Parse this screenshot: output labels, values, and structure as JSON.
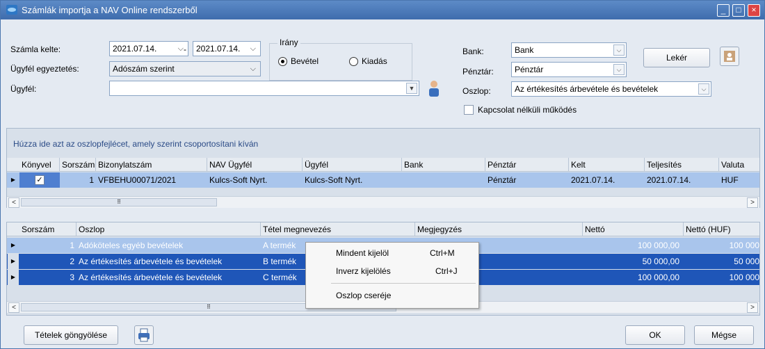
{
  "window": {
    "title": "Számlák importja a NAV Online rendszerből"
  },
  "filters": {
    "szamla_kelte_label": "Számla kelte:",
    "date_from": "2021.07.14.",
    "date_sep": "-",
    "date_to": "2021.07.14.",
    "ugyfel_egyeztetes_label": "Ügyfél egyeztetés:",
    "ugyfel_egyeztetes_value": "Adószám szerint",
    "ugyfel_label": "Ügyfél:",
    "ugyfel_value": ""
  },
  "irany": {
    "title": "Irány",
    "bevetel": "Bevétel",
    "kiadas": "Kiadás",
    "selected": "Bevétel"
  },
  "right": {
    "bank_label": "Bank:",
    "bank_value": "Bank",
    "penztar_label": "Pénztár:",
    "penztar_value": "Pénztár",
    "oszlop_label": "Oszlop:",
    "oszlop_value": "Az értékesítés árbevétele és bevételek",
    "kapcsolat_label": "Kapcsolat nélküli működés",
    "leker_label": "Lekér"
  },
  "group_hint": "Húzza ide azt az oszlopfejlécet, amely szerint csoportosítani kíván",
  "top_grid": {
    "headers": [
      "Könyvel",
      "Sorszám",
      "Bizonylatszám",
      "NAV Ügyfél",
      "Ügyfél",
      "Bank",
      "Pénztár",
      "Kelt",
      "Teljesítés",
      "Valuta"
    ],
    "rows": [
      {
        "konyvel": "✓",
        "sorszam": "1",
        "bizonylatszam": "VFBEHU00071/2021",
        "nav_ugyfel": "Kulcs-Soft Nyrt.",
        "ugyfel": "Kulcs-Soft Nyrt.",
        "bank": "",
        "penztar": "Pénztár",
        "kelt": "2021.07.14.",
        "teljesites": "2021.07.14.",
        "valuta": "HUF"
      }
    ]
  },
  "bottom_grid": {
    "headers": [
      "Sorszám",
      "Oszlop",
      "Tétel megnevezés",
      "Megjegyzés",
      "Nettó",
      "Nettó (HUF)"
    ],
    "rows": [
      {
        "sorszam": "1",
        "oszlop": "Adóköteles egyéb bevételek",
        "tetel": "A termék",
        "megjegyzes": "",
        "netto": "100 000,00",
        "netto_huf": "100 000"
      },
      {
        "sorszam": "2",
        "oszlop": "Az értékesítés árbevétele és bevételek",
        "tetel": "B termék",
        "megjegyzes": "",
        "netto": "50 000,00",
        "netto_huf": "50 000"
      },
      {
        "sorszam": "3",
        "oszlop": "Az értékesítés árbevétele és bevételek",
        "tetel": "C termék",
        "megjegyzes": "",
        "netto": "100 000,00",
        "netto_huf": "100 000"
      }
    ]
  },
  "context_menu": {
    "items": [
      {
        "label": "Mindent kijelöl",
        "shortcut": "Ctrl+M"
      },
      {
        "label": "Inverz kijelölés",
        "shortcut": "Ctrl+J"
      },
      {
        "label": "Oszlop cseréje",
        "shortcut": ""
      }
    ]
  },
  "footer": {
    "gongyoles_label": "Tételek göngyölése",
    "ok_label": "OK",
    "megse_label": "Mégse"
  },
  "colors": {
    "selected_row": "#1f56b8",
    "highlight_row": "#a9c5ec",
    "titlebar": "#4a7bbd"
  }
}
